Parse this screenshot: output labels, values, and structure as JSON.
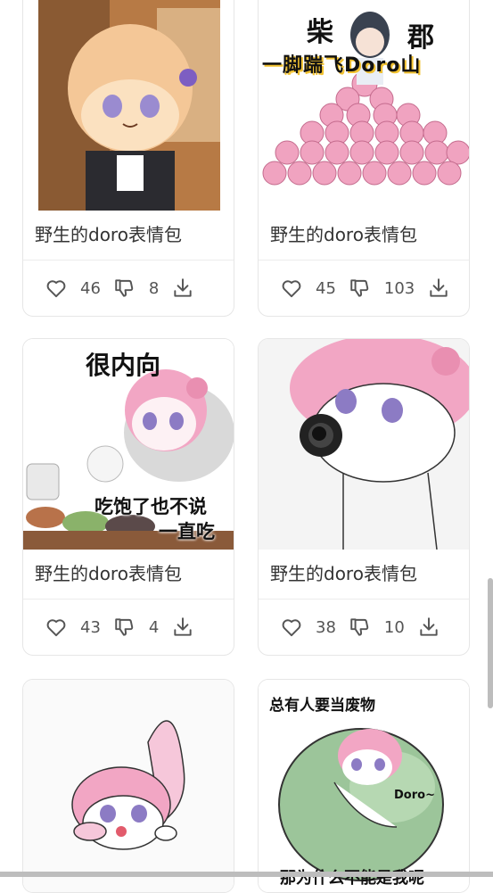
{
  "cards": [
    {
      "title": "野生的doro表情包",
      "likes": "46",
      "dislikes": "8"
    },
    {
      "title": "野生的doro表情包",
      "likes": "45",
      "dislikes": "103"
    },
    {
      "title": "野生的doro表情包",
      "likes": "43",
      "dislikes": "4"
    },
    {
      "title": "野生的doro表情包",
      "likes": "38",
      "dislikes": "10"
    }
  ],
  "image_captions": {
    "card2_top_left": "柴",
    "card2_top_right": "郡",
    "card2_banner": "一脚踹飞Doro山",
    "card3_top": "很内向",
    "card3_bottom_1": "吃饱了也不说",
    "card3_bottom_2": "一直吃",
    "card6_top": "总有人要当废物",
    "card6_label": "Doro~",
    "card6_bottom": "那为什么不能是我呢"
  },
  "icons": {
    "like": "heart-icon",
    "dislike": "thumbs-down-icon",
    "download": "download-icon"
  },
  "colors": {
    "card_border": "#e6e6e6",
    "text": "#333333",
    "icon": "#555555",
    "doro_pink": "#f2a6c4"
  }
}
